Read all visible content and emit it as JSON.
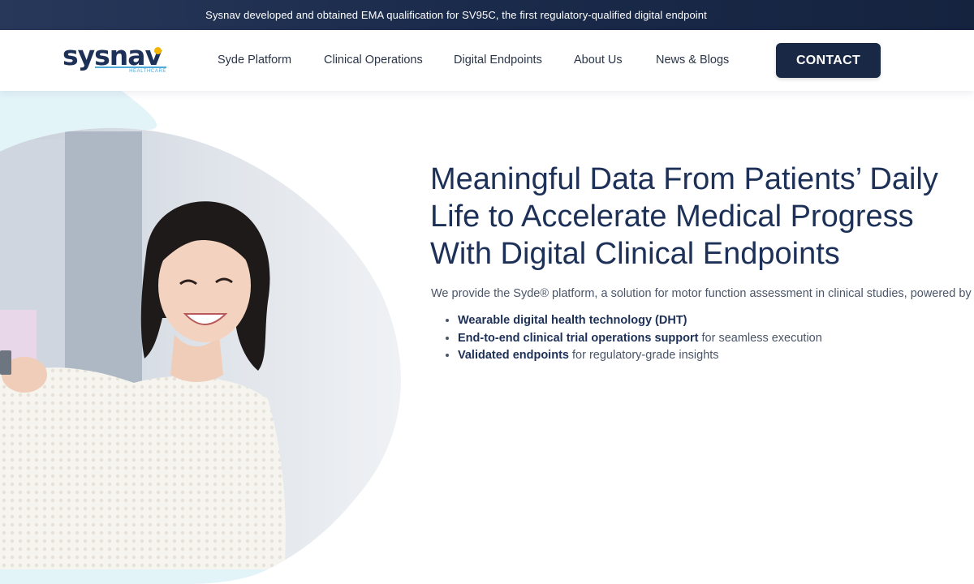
{
  "announcement": "Sysnav developed and obtained EMA qualification for SV95C, the first regulatory-qualified digital endpoint",
  "logo": {
    "wordmark": "sysnav",
    "sub": "HEALTHCARE"
  },
  "nav": {
    "items": [
      "Syde Platform",
      "Clinical Operations",
      "Digital Endpoints",
      "About Us",
      "News & Blogs"
    ],
    "contact": "CONTACT"
  },
  "hero": {
    "title_lines": [
      "Meaningful Data From Patients’ Daily",
      "Life to Accelerate Medical Progress",
      "With Digital Clinical Endpoints"
    ],
    "description": "We provide the Syde® platform, a solution for motor function assessment in clinical studies, powered by",
    "bullets": [
      {
        "bold": "Wearable digital health technology (DHT)",
        "rest": ""
      },
      {
        "bold": "End-to-end clinical trial operations support",
        "rest": " for seamless execution"
      },
      {
        "bold": "Validated endpoints",
        "rest": " for regulatory-grade insights"
      }
    ]
  },
  "colors": {
    "navy": "#1d3057",
    "announce_bg": "#1a2a4a",
    "light_blob": "#e3f4f9",
    "accent_blue": "#4fa9d9",
    "accent_yellow": "#f5b400"
  }
}
